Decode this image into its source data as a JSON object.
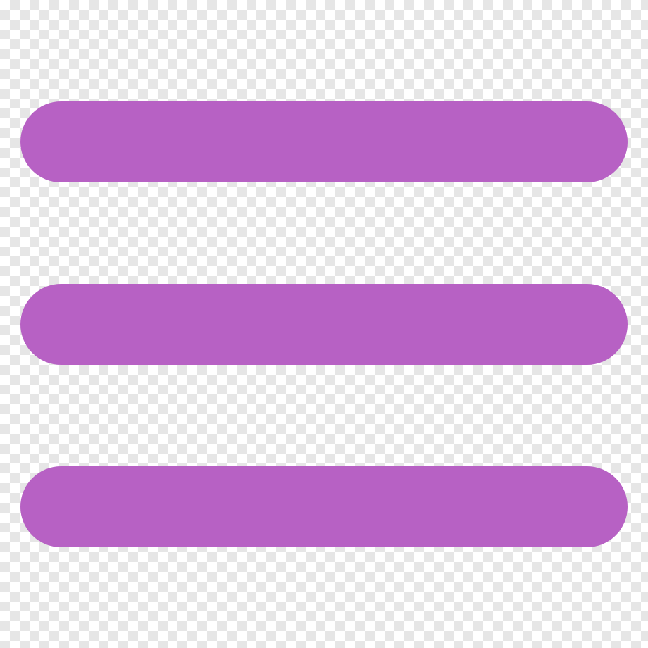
{
  "image": {
    "subject": "hamburger-menu-icon",
    "background": "transparency-checkerboard",
    "colors": {
      "icon_fill": "#b761c4",
      "checker_light": "#ffffff",
      "checker_dark": "#e6e6e6"
    },
    "lines": [
      {
        "name": "top-line"
      },
      {
        "name": "middle-line"
      },
      {
        "name": "bottom-line"
      }
    ]
  }
}
